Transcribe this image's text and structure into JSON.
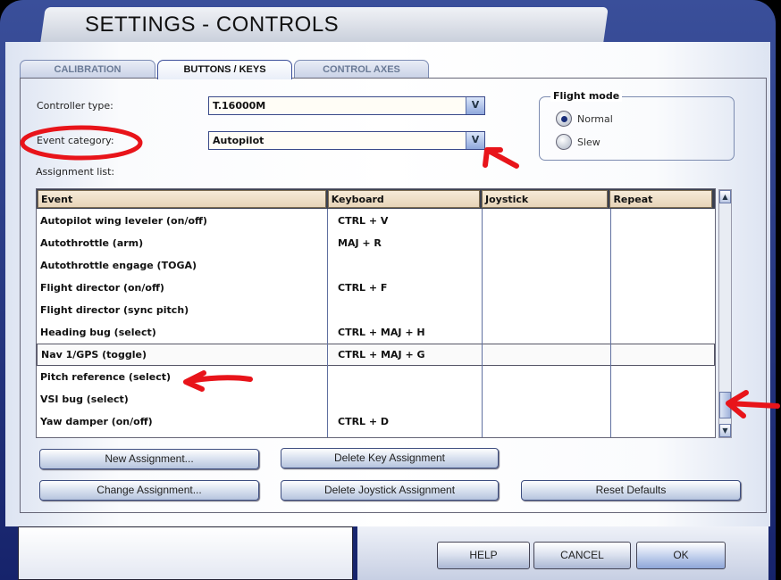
{
  "window": {
    "title": "SETTINGS - CONTROLS"
  },
  "tabs": [
    {
      "label": "CALIBRATION",
      "active": false
    },
    {
      "label": "BUTTONS / KEYS",
      "active": true
    },
    {
      "label": "CONTROL AXES",
      "active": false
    }
  ],
  "controller_type": {
    "label": "Controller type:",
    "value": "T.16000M"
  },
  "event_category": {
    "label": "Event category:",
    "value": "Autopilot"
  },
  "assignment_list_label": "Assignment list:",
  "flight_mode": {
    "title": "Flight mode",
    "options": [
      {
        "label": "Normal",
        "selected": true
      },
      {
        "label": "Slew",
        "selected": false
      }
    ]
  },
  "table": {
    "columns": [
      "Event",
      "Keyboard",
      "Joystick",
      "Repeat"
    ],
    "rows": [
      {
        "event": "Autopilot wing leveler (on/off)",
        "keyboard": "CTRL + V",
        "joystick": "",
        "repeat": ""
      },
      {
        "event": "Autothrottle (arm)",
        "keyboard": "MAJ + R",
        "joystick": "",
        "repeat": ""
      },
      {
        "event": "Autothrottle engage (TOGA)",
        "keyboard": "",
        "joystick": "",
        "repeat": ""
      },
      {
        "event": "Flight director (on/off)",
        "keyboard": "CTRL + F",
        "joystick": "",
        "repeat": ""
      },
      {
        "event": "Flight director (sync pitch)",
        "keyboard": "",
        "joystick": "",
        "repeat": ""
      },
      {
        "event": "Heading bug (select)",
        "keyboard": "CTRL + MAJ + H",
        "joystick": "",
        "repeat": ""
      },
      {
        "event": "Nav 1/GPS (toggle)",
        "keyboard": "CTRL + MAJ + G",
        "joystick": "",
        "repeat": "",
        "selected": true
      },
      {
        "event": "Pitch reference (select)",
        "keyboard": "",
        "joystick": "",
        "repeat": ""
      },
      {
        "event": "VSI bug (select)",
        "keyboard": "",
        "joystick": "",
        "repeat": ""
      },
      {
        "event": "Yaw damper (on/off)",
        "keyboard": "CTRL + D",
        "joystick": "",
        "repeat": ""
      }
    ]
  },
  "buttons": {
    "new": "New Assignment...",
    "delete_key": "Delete Key Assignment",
    "change": "Change Assignment...",
    "delete_joystick": "Delete Joystick Assignment",
    "reset": "Reset Defaults"
  },
  "footer": {
    "help": "HELP",
    "cancel": "CANCEL",
    "ok": "OK"
  },
  "colors": {
    "frame": "#1e2d78",
    "annotation": "#e8141a",
    "header_cell": "#efe0c8"
  }
}
